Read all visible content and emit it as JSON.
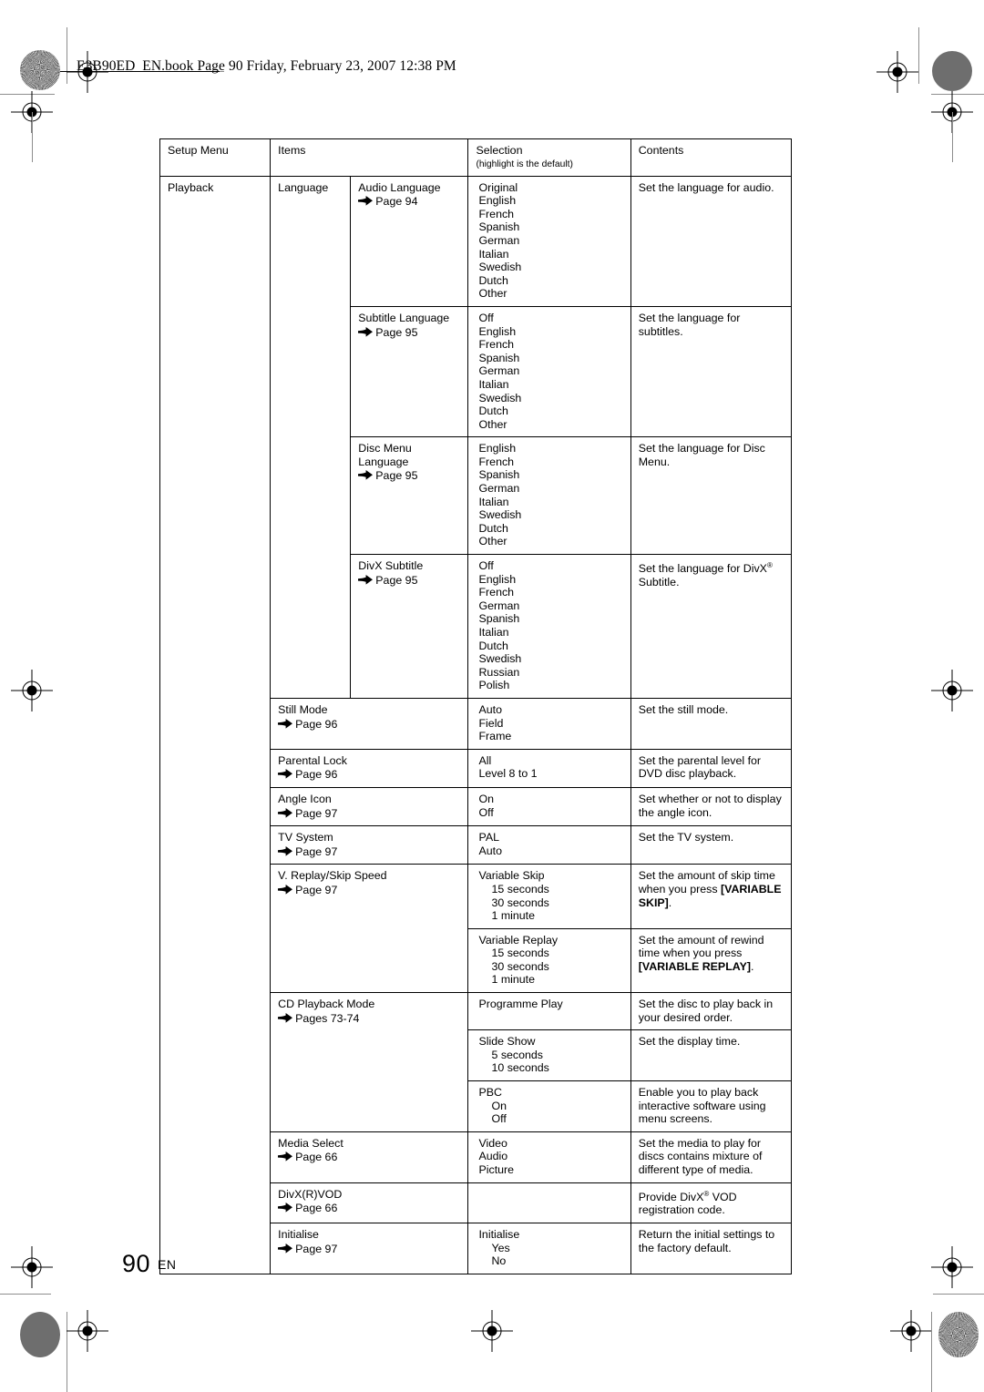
{
  "header": {
    "slug": "E3B90ED_EN.book  Page 90  Friday, February 23, 2007  12:38 PM"
  },
  "footer": {
    "page_number": "90",
    "language_code": "EN"
  },
  "colors": {
    "selection_bg": "#9a9a9a",
    "highlight_bg": "#ffffff",
    "border": "#000000",
    "page_bg": "#ffffff"
  },
  "table": {
    "columns": [
      {
        "label": "Setup Menu",
        "sub": ""
      },
      {
        "label": "Items",
        "sub": ""
      },
      {
        "label": "Selection",
        "sub": "(highlight is the default)"
      },
      {
        "label": "Contents",
        "sub": ""
      }
    ],
    "setup_menu": "Playback",
    "groups": [
      {
        "name": "Language",
        "rows": [
          {
            "item": "Audio Language",
            "page_ref": "Page 94",
            "options": [
              {
                "label": "Original",
                "highlight": true
              },
              {
                "label": "English",
                "highlight": false
              },
              {
                "label": "French",
                "highlight": false
              },
              {
                "label": "Spanish",
                "highlight": false
              },
              {
                "label": "German",
                "highlight": false
              },
              {
                "label": "Italian",
                "highlight": false
              },
              {
                "label": "Swedish",
                "highlight": false
              },
              {
                "label": "Dutch",
                "highlight": false
              },
              {
                "label": "Other",
                "highlight": false
              }
            ],
            "contents": "Set the language for audio."
          },
          {
            "item": "Subtitle Language",
            "page_ref": "Page 95",
            "options": [
              {
                "label": "Off",
                "highlight": true
              },
              {
                "label": "English",
                "highlight": false
              },
              {
                "label": "French",
                "highlight": false
              },
              {
                "label": "Spanish",
                "highlight": false
              },
              {
                "label": "German",
                "highlight": false
              },
              {
                "label": "Italian",
                "highlight": false
              },
              {
                "label": "Swedish",
                "highlight": false
              },
              {
                "label": "Dutch",
                "highlight": false
              },
              {
                "label": "Other",
                "highlight": false
              }
            ],
            "contents": "Set the language for subtitles."
          },
          {
            "item": "Disc Menu Language",
            "page_ref": "Page 95",
            "options": [
              {
                "label": "English",
                "highlight": true
              },
              {
                "label": "French",
                "highlight": false
              },
              {
                "label": "Spanish",
                "highlight": false
              },
              {
                "label": "German",
                "highlight": false
              },
              {
                "label": "Italian",
                "highlight": false
              },
              {
                "label": "Swedish",
                "highlight": false
              },
              {
                "label": "Dutch",
                "highlight": false
              },
              {
                "label": "Other",
                "highlight": false
              }
            ],
            "contents": "Set the language for Disc Menu."
          },
          {
            "item": "DivX Subtitle",
            "page_ref": "Page 95",
            "options": [
              {
                "label": "Off",
                "highlight": true
              },
              {
                "label": "English",
                "highlight": false
              },
              {
                "label": "French",
                "highlight": false
              },
              {
                "label": "German",
                "highlight": false
              },
              {
                "label": "Spanish",
                "highlight": false
              },
              {
                "label": "Italian",
                "highlight": false
              },
              {
                "label": "Dutch",
                "highlight": false
              },
              {
                "label": "Swedish",
                "highlight": false
              },
              {
                "label": "Russian",
                "highlight": false
              },
              {
                "label": "Polish",
                "highlight": false
              }
            ],
            "contents_html": "Set the language for DivX® Subtitle."
          }
        ]
      }
    ],
    "simple_rows": [
      {
        "item": "Still Mode",
        "page_ref": "Page 96",
        "options": [
          {
            "label": "Auto",
            "highlight": true
          },
          {
            "label": "Field",
            "highlight": false
          },
          {
            "label": "Frame",
            "highlight": false
          }
        ],
        "contents": "Set the still mode."
      },
      {
        "item": "Parental Lock",
        "page_ref": "Page 96",
        "options": [
          {
            "label": "All",
            "highlight": true
          },
          {
            "label": "Level 8 to 1",
            "highlight": false
          }
        ],
        "contents": "Set the parental level for DVD disc playback."
      },
      {
        "item": "Angle Icon",
        "page_ref": "Page 97",
        "options": [
          {
            "label": "On",
            "highlight": false
          },
          {
            "label": "Off",
            "highlight": true
          }
        ],
        "contents": "Set whether or not to display the angle icon."
      },
      {
        "item": "TV System",
        "page_ref": "Page 97",
        "options": [
          {
            "label": "PAL",
            "highlight": true
          },
          {
            "label": "Auto",
            "highlight": false
          }
        ],
        "contents": "Set the TV system."
      }
    ],
    "multi_rows": [
      {
        "item": "V. Replay/Skip Speed",
        "page_ref": "Page 97",
        "subrows": [
          {
            "sub_title": "Variable Skip",
            "options": [
              {
                "label": "15 seconds",
                "highlight": false,
                "indent": true
              },
              {
                "label": "30 seconds",
                "highlight": true,
                "indent": true
              },
              {
                "label": "1 minute",
                "highlight": false,
                "indent": true
              }
            ],
            "contents_pre": "Set the amount of skip time when you press ",
            "contents_bold": "[VARIABLE SKIP]",
            "contents_post": "."
          },
          {
            "sub_title": "Variable Replay",
            "options": [
              {
                "label": "15 seconds",
                "highlight": true,
                "indent": true
              },
              {
                "label": "30 seconds",
                "highlight": false,
                "indent": true
              },
              {
                "label": "1 minute",
                "highlight": false,
                "indent": true
              }
            ],
            "contents_pre": "Set the amount of rewind time when you press ",
            "contents_bold": "[VARIABLE REPLAY]",
            "contents_post": "."
          }
        ]
      },
      {
        "item": "CD Playback Mode",
        "page_ref": "Pages 73-74",
        "subrows": [
          {
            "sub_title": "Programme Play",
            "options": [],
            "contents_pre": "Set the disc to play back in your desired order.",
            "contents_bold": "",
            "contents_post": ""
          },
          {
            "sub_title": "Slide Show",
            "options": [
              {
                "label": "5 seconds",
                "highlight": true,
                "indent": true
              },
              {
                "label": "10 seconds",
                "highlight": false,
                "indent": true
              }
            ],
            "contents_pre": "Set the display time.",
            "contents_bold": "",
            "contents_post": ""
          },
          {
            "sub_title": "PBC",
            "options": [
              {
                "label": "On",
                "highlight": true,
                "indent": true
              },
              {
                "label": "Off",
                "highlight": false,
                "indent": true
              }
            ],
            "contents_pre": "Enable you to play back interactive software using menu screens.",
            "contents_bold": "",
            "contents_post": ""
          }
        ]
      }
    ],
    "tail_rows": [
      {
        "item": "Media Select",
        "page_ref": "Page 66",
        "options": [
          {
            "label": "Video",
            "highlight": true
          },
          {
            "label": "Audio",
            "highlight": false
          },
          {
            "label": "Picture",
            "highlight": false
          }
        ],
        "contents": "Set the media to play for discs contains mixture of different type of media."
      },
      {
        "item": "DivX(R)VOD",
        "page_ref": "Page 66",
        "options": [],
        "contents_html": "Provide DivX® VOD registration code."
      },
      {
        "item": "Initialise",
        "page_ref": "Page 97",
        "sub_title": "Initialise",
        "options": [
          {
            "label": "Yes",
            "highlight": false,
            "indent": true
          },
          {
            "label": "No",
            "highlight": true,
            "indent": true
          }
        ],
        "contents": "Return the initial settings to the factory default."
      }
    ]
  },
  "icons": {
    "page_arrow": "right-arrow-icon",
    "registration": "registration-mark-icon",
    "rosette": "print-rosette-icon"
  }
}
